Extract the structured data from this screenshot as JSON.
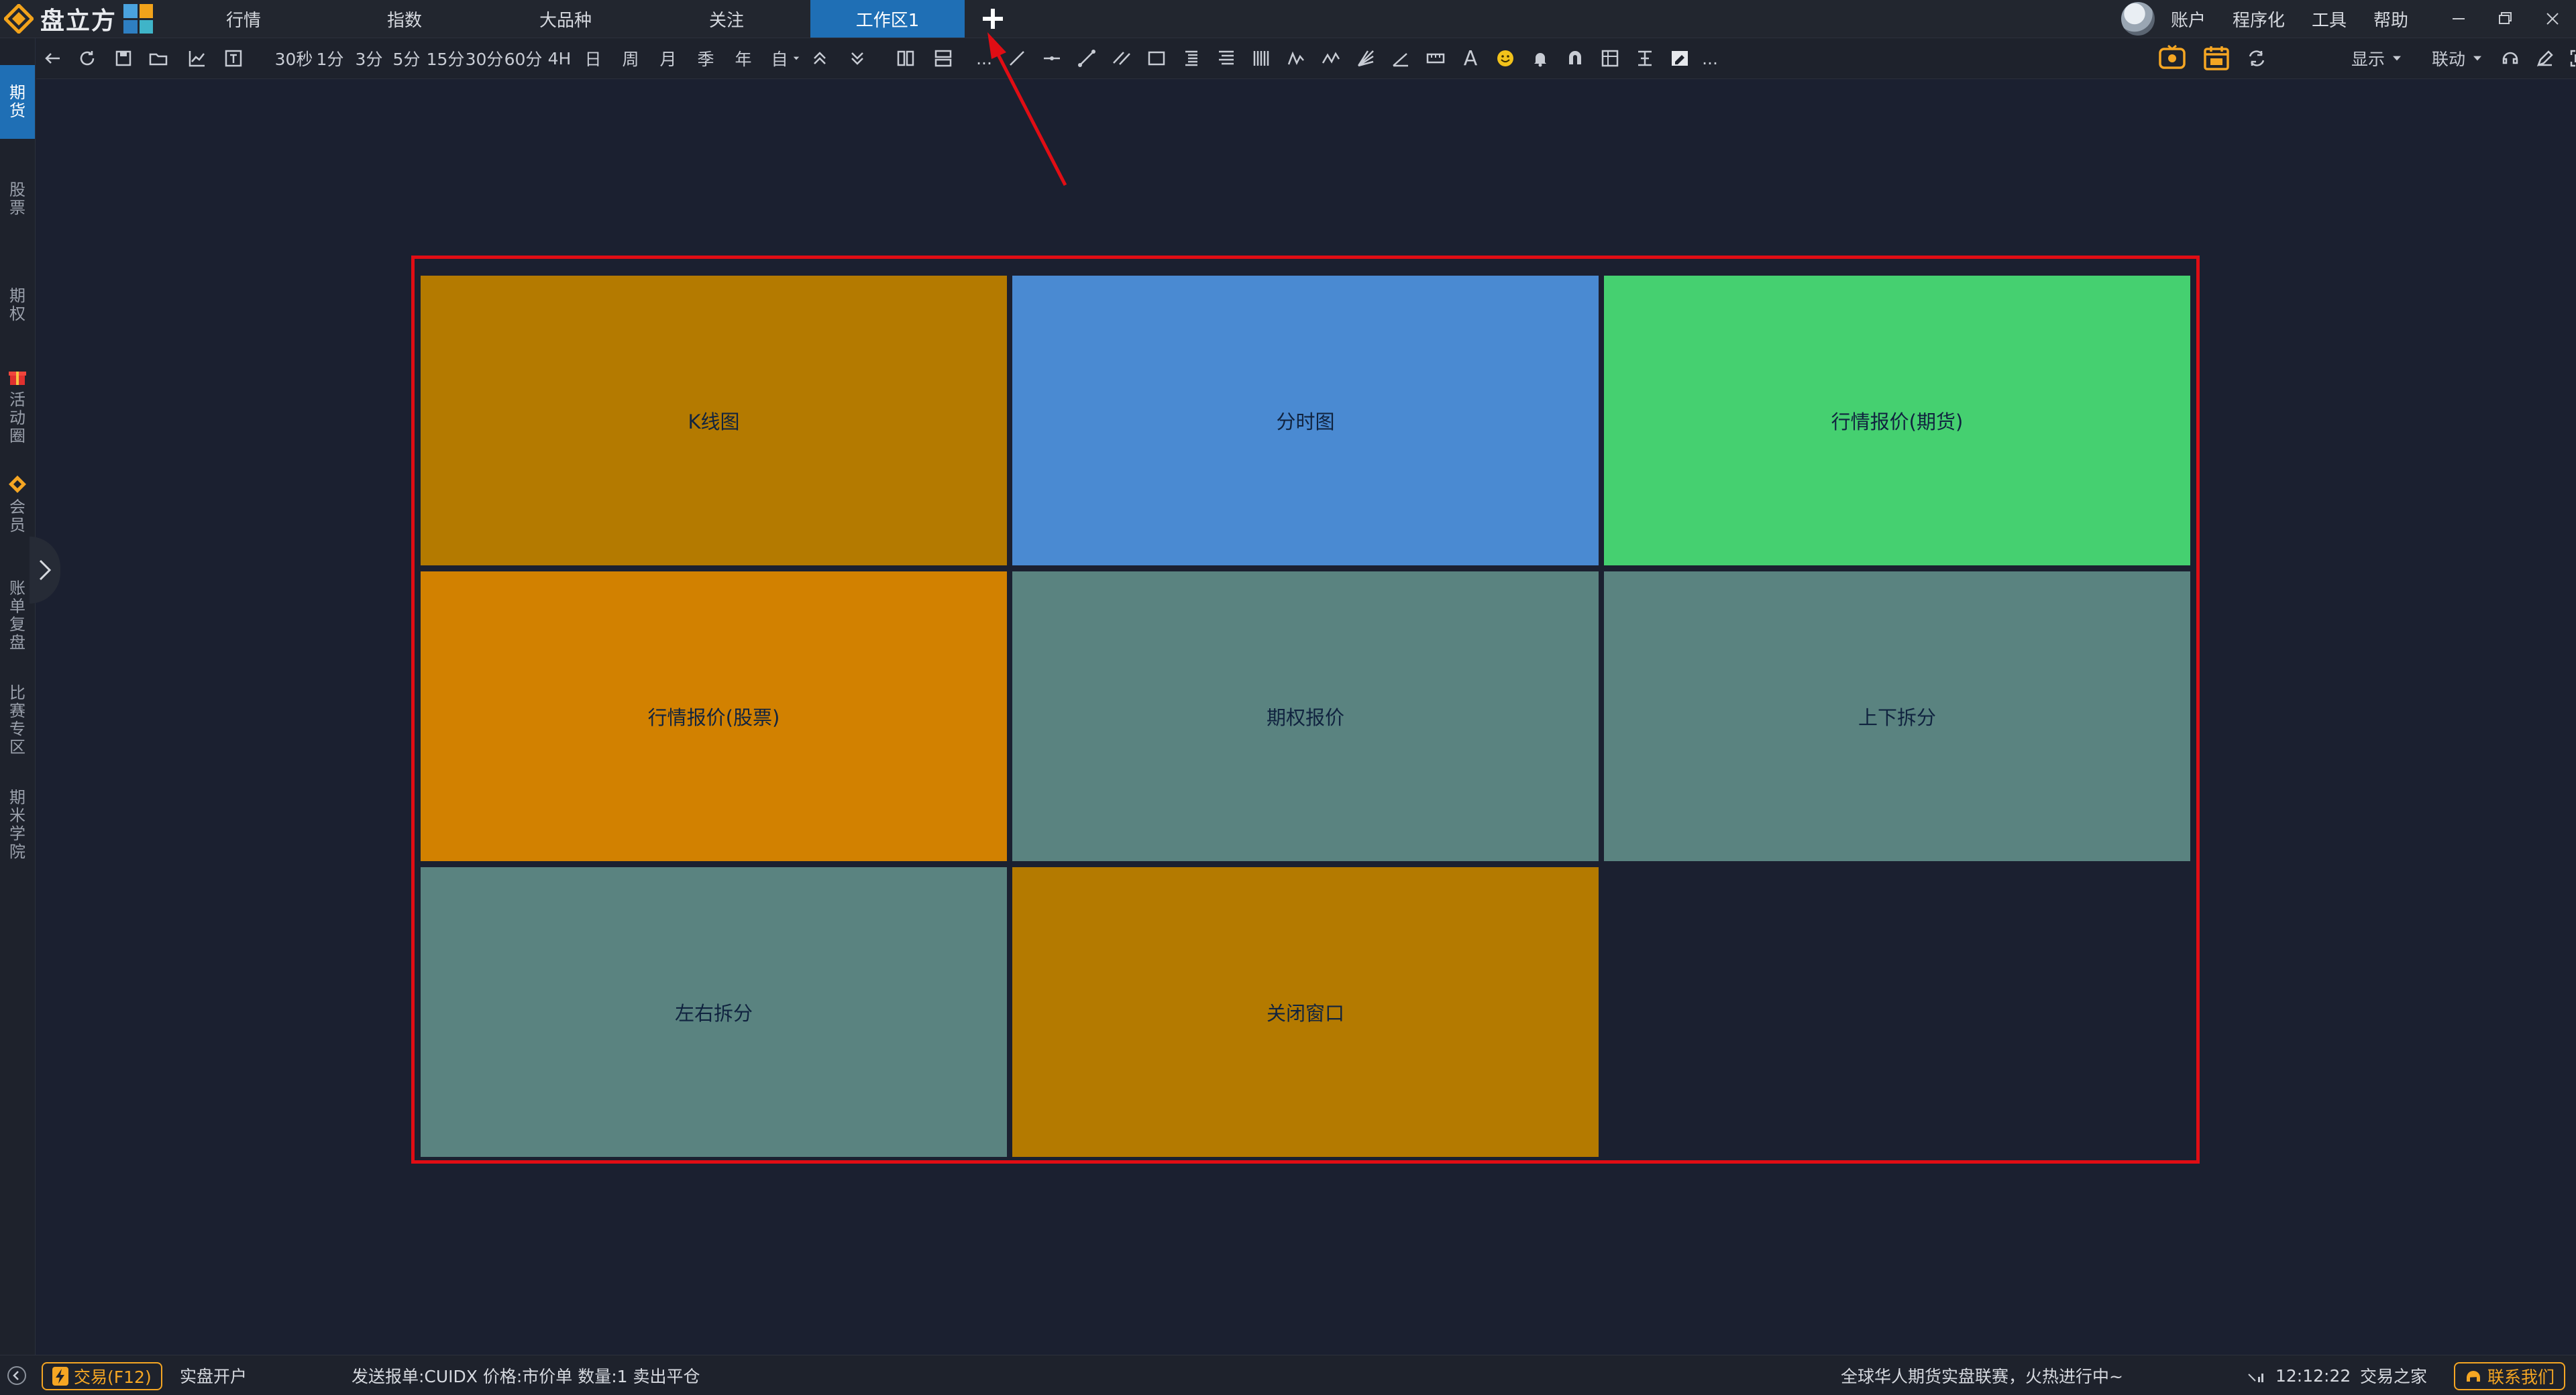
{
  "app": {
    "name": "盘立方"
  },
  "nav": {
    "tabs": [
      {
        "label": "行情"
      },
      {
        "label": "指数"
      },
      {
        "label": "大品种"
      },
      {
        "label": "关注"
      },
      {
        "label": "工作区1",
        "active": true
      }
    ],
    "add_tab_icon": "plus-icon"
  },
  "top_right": {
    "items": [
      {
        "label": "账户"
      },
      {
        "label": "程序化"
      },
      {
        "label": "工具"
      },
      {
        "label": "帮助"
      }
    ],
    "window_controls": [
      "minimize-icon",
      "restore-icon",
      "close-icon"
    ]
  },
  "toolbar": {
    "periods": [
      "30秒",
      "1分",
      "3分",
      "5分",
      "15分",
      "30分",
      "60分",
      "4H",
      "日",
      "周",
      "月",
      "季",
      "年",
      "自"
    ],
    "more_1": "...",
    "more_2": "...",
    "text_tool": "A",
    "display_label": "显示",
    "link_label": "联动"
  },
  "sidebar": {
    "items": [
      {
        "label": "期货",
        "active": true
      },
      {
        "label": "股票"
      },
      {
        "label": "期权"
      },
      {
        "label": "活动圈",
        "icon": "gift-icon"
      },
      {
        "label": "会员",
        "icon": "member-icon"
      },
      {
        "label": "账单复盘"
      },
      {
        "label": "比赛专区"
      },
      {
        "label": "期米学院"
      }
    ]
  },
  "layout_grid": {
    "cells": [
      {
        "label": "K线图",
        "color": "#b47a00"
      },
      {
        "label": "分时图",
        "color": "#4a8ad2"
      },
      {
        "label": "行情报价(期货)",
        "color": "#45d070"
      },
      {
        "label": "行情报价(股票)",
        "color": "#d28100"
      },
      {
        "label": "期权报价",
        "color": "#5a8380"
      },
      {
        "label": "上下拆分",
        "color": "#5a8380"
      },
      {
        "label": "左右拆分",
        "color": "#5a8380"
      },
      {
        "label": "关闭窗口",
        "color": "#b47a00"
      }
    ],
    "frame_color": "#e10d14"
  },
  "statusbar": {
    "trade_label": "交易(F12)",
    "open_account_label": "实盘开户",
    "order_message": "发送报单:CUIDX 价格:市价单  数量:1 卖出平仓",
    "ticker": "全球华人期货实盘联赛，火热进行中~",
    "time": "12:12:22",
    "home_label": "交易之家",
    "contact_label": "联系我们"
  },
  "colors": {
    "accent": "#1f6fb5",
    "warning": "#f5a623",
    "annotation": "#e10d14"
  }
}
